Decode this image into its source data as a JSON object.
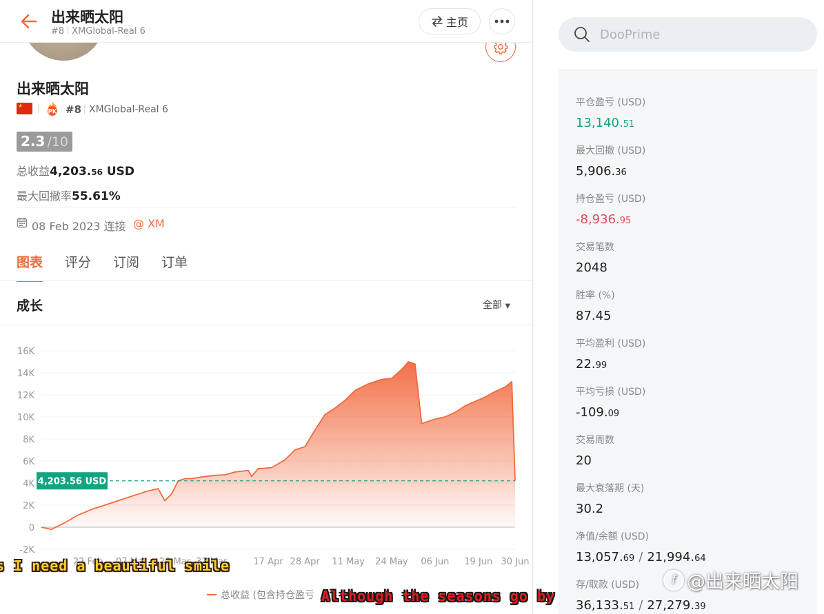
{
  "header": {
    "title": "出来晒太阳",
    "rank": "#8",
    "account": "XMGlobal-Real 6",
    "home_label": "主页",
    "home_icon": "swap-arrows-icon",
    "more_icon": "ellipsis-icon"
  },
  "profile": {
    "name": "出来晒太阳",
    "flag": "china-flag-icon",
    "rank": "#8",
    "account": "XMGlobal-Real 6",
    "score": "2.3",
    "score_max": "/10",
    "total_profit_label": "总收益",
    "total_profit_main": "4,203.",
    "total_profit_dec": "56",
    "total_profit_unit": " USD",
    "max_drawdown_label": "最大回撤率",
    "max_drawdown": "55.61%",
    "joined": "08 Feb 2023 连接",
    "broker": "@ XM"
  },
  "tabs": [
    {
      "label": "图表",
      "active": true
    },
    {
      "label": "评分",
      "active": false
    },
    {
      "label": "订阅",
      "active": false
    },
    {
      "label": "订单",
      "active": false
    }
  ],
  "chart_section": {
    "title": "成长",
    "range_label": "全部",
    "legend": "总收益 (包含持仓盈亏"
  },
  "chart_data": {
    "type": "area",
    "series": [
      {
        "name": "总收益 (包含持仓盈亏",
        "x": [
          "2023-02-08",
          "2023-02-11",
          "2023-02-15",
          "2023-02-19",
          "2023-02-23",
          "2023-02-27",
          "2023-03-03",
          "2023-03-07",
          "2023-03-11",
          "2023-03-15",
          "2023-03-17",
          "2023-03-19",
          "2023-03-21",
          "2023-03-23",
          "2023-03-25",
          "2023-03-28",
          "2023-04-01",
          "2023-04-04",
          "2023-04-07",
          "2023-04-11",
          "2023-04-12",
          "2023-04-14",
          "2023-04-18",
          "2023-04-22",
          "2023-04-25",
          "2023-04-28",
          "2023-05-01",
          "2023-05-04",
          "2023-05-07",
          "2023-05-10",
          "2023-05-13",
          "2023-05-17",
          "2023-05-21",
          "2023-05-24",
          "2023-05-27",
          "2023-05-29",
          "2023-05-31",
          "2023-06-02",
          "2023-06-06",
          "2023-06-09",
          "2023-06-12",
          "2023-06-15",
          "2023-06-18",
          "2023-06-21",
          "2023-06-24",
          "2023-06-27",
          "2023-06-29",
          "2023-06-30"
        ],
        "values": [
          0,
          -200,
          400,
          1100,
          1600,
          2000,
          2400,
          2800,
          3200,
          3500,
          2400,
          3000,
          4200,
          4400,
          4400,
          4550,
          4700,
          4750,
          5000,
          5150,
          4600,
          5300,
          5400,
          6100,
          7000,
          7300,
          8800,
          10200,
          10800,
          11500,
          12400,
          13000,
          13400,
          13500,
          14300,
          15000,
          14800,
          9400,
          9800,
          10000,
          10400,
          11000,
          11400,
          11800,
          12300,
          12700,
          13200,
          4203.56
        ]
      }
    ],
    "current_marker": {
      "value": 4203.56,
      "label": "4,203.56 USD"
    },
    "ylim": [
      -2000,
      16000
    ],
    "yticks": [
      -2000,
      0,
      2000,
      4000,
      6000,
      8000,
      10000,
      12000,
      14000,
      16000
    ],
    "ytick_labels": [
      "-2K",
      "0",
      "2K",
      "4K",
      "6K",
      "8K",
      "10K",
      "12K",
      "14K",
      "16K"
    ],
    "xticks": [
      "2023-02-22",
      "2023-03-07",
      "2023-03-20",
      "2023-03-31",
      "2023-04-17",
      "2023-04-28",
      "2023-05-11",
      "2023-05-24",
      "2023-06-06",
      "2023-06-19",
      "2023-06-30"
    ],
    "xtick_labels": [
      "22 Feb",
      "07 Mar",
      "20 Mar",
      "31 Mar",
      "17 Apr",
      "28 Apr",
      "11 May",
      "24 May",
      "06 Jun",
      "19 Jun",
      "30 Jun"
    ],
    "xlim": [
      "2023-02-08",
      "2023-06-30"
    ],
    "grid": true,
    "colors": {
      "line": "#f06a3d",
      "marker": "#12a481"
    }
  },
  "search": {
    "placeholder": "DooPrime"
  },
  "stats": [
    {
      "label": "平仓盈亏 (USD)",
      "main": "13,140.",
      "dec": "51",
      "style": "green"
    },
    {
      "label": "最大回撤 (USD)",
      "main": "5,906.",
      "dec": "36",
      "style": ""
    },
    {
      "label": "持仓盈亏 (USD)",
      "main": "-8,936.",
      "dec": "95",
      "style": "red"
    },
    {
      "label": "交易笔数",
      "main": "2048",
      "dec": "",
      "style": ""
    },
    {
      "label": "胜率 (%)",
      "main": "87.45",
      "dec": "",
      "style": ""
    },
    {
      "label": "平均盈利 (USD)",
      "main": "22.",
      "dec": "99",
      "style": ""
    },
    {
      "label": "平均亏损 (USD)",
      "main": "-109.",
      "dec": "09",
      "style": ""
    },
    {
      "label": "交易周数",
      "main": "20",
      "dec": "",
      "style": ""
    },
    {
      "label": "最大衰落期 (天)",
      "main": "30.2",
      "dec": "",
      "style": ""
    }
  ],
  "pair_stats": [
    {
      "label": "净值/余额 (USD)",
      "a_main": "13,057.",
      "a_dec": "69",
      "sep": "/",
      "b_main": "21,994.",
      "b_dec": "64"
    },
    {
      "label": "存/取款 (USD)",
      "a_main": "36,133.",
      "a_dec": "51",
      "sep": "/",
      "b_main": "27,279.",
      "b_dec": "39"
    }
  ],
  "overlays": {
    "subtitle_1": "s I need a beautiful smile",
    "subtitle_2": "Although the seasons go by",
    "watermark": "@出来晒太阳"
  },
  "colors": {
    "accent": "#f06a3d",
    "green": "#13a47f",
    "red": "#e24a58"
  }
}
